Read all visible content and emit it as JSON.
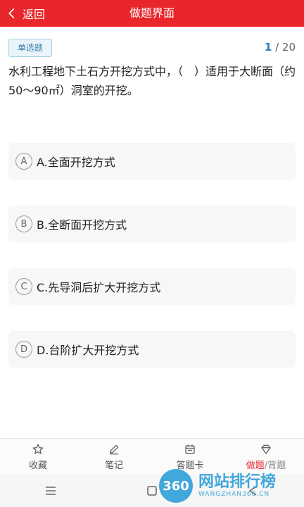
{
  "header": {
    "back_label": "返回",
    "title": "做题界面"
  },
  "question": {
    "type_tag": "单选题",
    "index_current": "1",
    "index_total": "/ 20",
    "text": "水利工程地下土石方开挖方式中，（　）适用于大断面（约50～90㎡）洞室的开挖。"
  },
  "options": [
    {
      "letter": "A",
      "text": "A.全面开挖方式"
    },
    {
      "letter": "B",
      "text": "B.全断面开挖方式"
    },
    {
      "letter": "C",
      "text": "C.先导洞后扩大开挖方式"
    },
    {
      "letter": "D",
      "text": "D.台阶扩大开挖方式"
    }
  ],
  "bottom_nav": {
    "favorite": "收藏",
    "notes": "笔记",
    "answer_card": "答题卡",
    "mode_active": "做题",
    "mode_sep": "/",
    "mode_inactive": "背题"
  },
  "watermark": {
    "badge": "360",
    "main": "网站排行榜",
    "sub": "WANGZHAN360.CN"
  },
  "colors": {
    "accent": "#e8262b",
    "progress": "#2d7fc1",
    "tag_bg": "#e9f5fb"
  }
}
